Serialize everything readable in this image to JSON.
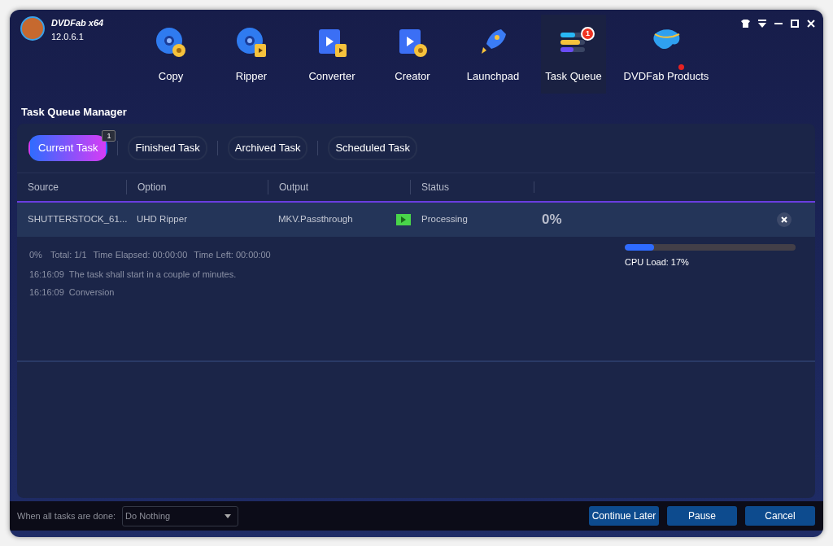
{
  "app": {
    "name": "DVDFab x64",
    "version": "12.0.6.1"
  },
  "nav": [
    {
      "label": "Copy",
      "kind": "copy",
      "selected": false,
      "notification": false
    },
    {
      "label": "Ripper",
      "kind": "ripper",
      "selected": false,
      "notification": false
    },
    {
      "label": "Converter",
      "kind": "converter",
      "selected": false,
      "notification": false
    },
    {
      "label": "Creator",
      "kind": "creator",
      "selected": false,
      "notification": false
    },
    {
      "label": "Launchpad",
      "kind": "launchpad",
      "selected": false,
      "notification": false
    },
    {
      "label": "Task Queue",
      "kind": "queue",
      "selected": true,
      "notification": false,
      "badge": "1"
    },
    {
      "label": "DVDFab Products",
      "kind": "products",
      "selected": false,
      "notification": true
    }
  ],
  "page_title": "Task Queue Manager",
  "tabs": [
    {
      "label": "Current Task",
      "selected": true,
      "badge": "1"
    },
    {
      "label": "Finished Task",
      "selected": false
    },
    {
      "label": "Archived Task",
      "selected": false
    },
    {
      "label": "Scheduled Task",
      "selected": false
    }
  ],
  "table": {
    "columns": [
      "Source",
      "Option",
      "Output",
      "Status"
    ],
    "rows": [
      {
        "source": "SHUTTERSTOCK_61...",
        "option": "UHD Ripper",
        "output": "MKV.Passthrough",
        "status": "Processing",
        "progress": "0%",
        "selected": true
      }
    ]
  },
  "details": {
    "summary": [
      "0%",
      "Total: 1/1",
      "Time Elapsed: 00:00:00",
      "Time Left: 00:00:00"
    ],
    "log": [
      {
        "time": "16:16:09",
        "message": "The task shall start in a couple of minutes."
      },
      {
        "time": "16:16:09",
        "message": "Conversion"
      }
    ],
    "cpu": {
      "level": 0.17,
      "label": "CPU Load: 17%"
    }
  },
  "footer": {
    "label": "When all tasks are done:",
    "select": {
      "value": "Do Nothing"
    },
    "buttons": [
      "Continue Later",
      "Pause",
      "Cancel"
    ]
  }
}
